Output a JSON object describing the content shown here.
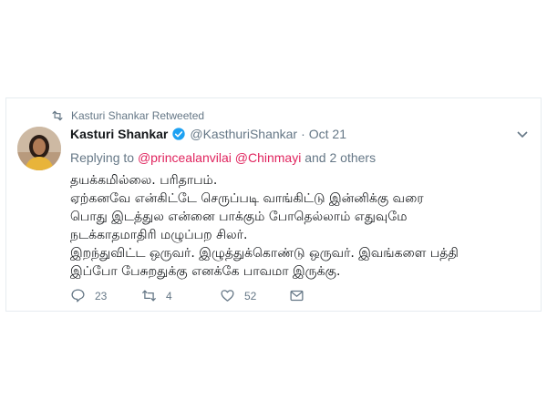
{
  "retweet_context": {
    "text": "Kasturi Shankar Retweeted",
    "icon": "retweet-icon"
  },
  "author": {
    "display_name": "Kasturi Shankar",
    "handle": "@KasthuriShankar",
    "separator": "·",
    "date": "Oct 21",
    "verified": true
  },
  "reply_to": {
    "prefix": "Replying to ",
    "mention_1": "@princealanvilai",
    "mention_2": "@Chinmayi",
    "suffix": " and 2 others"
  },
  "tweet_lines": [
    "தயக்கமில்லை. பரிதாபம்.",
    "ஏற்கனவே என்கிட்டே செருப்படி வாங்கிட்டு  இன்னிக்கு வரை",
    "பொது இடத்துல என்னை பாக்கும் போதெல்லாம் எதுவுமே",
    "நடக்காதமாதிரி மழுப்பற சிலர்.",
    "இறந்துவிட்ட ஒருவர்.  இழுத்துக்கொண்டு ஒருவர். இவங்களை பத்தி",
    "இப்போ பேசுறதுக்கு எனக்கே பாவமா இருக்கு."
  ],
  "actions": {
    "reply_count": "23",
    "retweet_count": "4",
    "like_count": "52"
  },
  "colors": {
    "muted": "#657786",
    "mention": "#e0245e",
    "verified": "#1da1f2",
    "retweet": "#17bf63"
  }
}
